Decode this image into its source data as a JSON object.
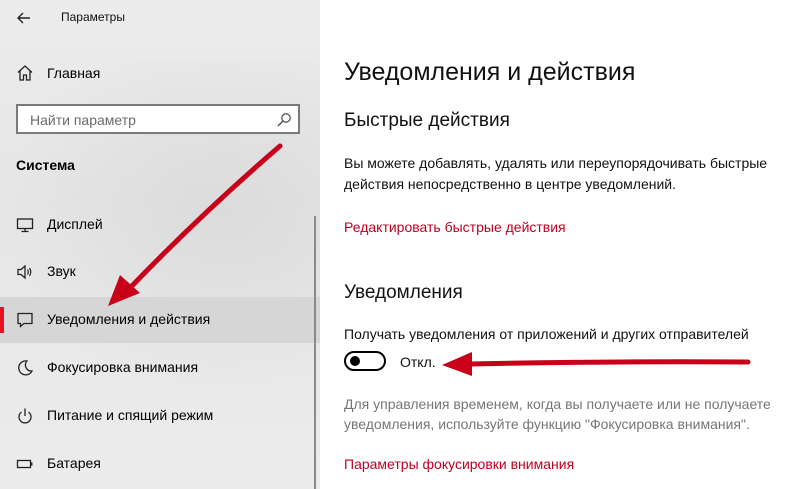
{
  "window": {
    "title": "Параметры"
  },
  "sidebar": {
    "home_label": "Главная",
    "search_placeholder": "Найти параметр",
    "section_title": "Система",
    "items": [
      {
        "label": "Дисплей",
        "icon": "monitor-icon",
        "active": false
      },
      {
        "label": "Звук",
        "icon": "speaker-icon",
        "active": false
      },
      {
        "label": "Уведомления и действия",
        "icon": "message-icon",
        "active": true
      },
      {
        "label": "Фокусировка внимания",
        "icon": "moon-icon",
        "active": false
      },
      {
        "label": "Питание и спящий режим",
        "icon": "power-icon",
        "active": false
      },
      {
        "label": "Батарея",
        "icon": "battery-icon",
        "active": false
      }
    ]
  },
  "main": {
    "title": "Уведомления и действия",
    "quick_actions": {
      "heading": "Быстрые действия",
      "description": "Вы можете добавлять, удалять или переупорядочивать быстрые действия непосредственно в центре уведомлений.",
      "edit_link": "Редактировать быстрые действия"
    },
    "notifications": {
      "heading": "Уведомления",
      "setting_label": "Получать уведомления от приложений и других отправителей",
      "toggle_state": "Откл.",
      "toggle_on": false,
      "hint": "Для управления временем, когда вы получаете или не получаете уведомления, используйте функцию \"Фокусировка внимания\".",
      "focus_link": "Параметры фокусировки внимания"
    }
  },
  "colors": {
    "accent": "#e81123",
    "link": "#c00021",
    "annotation_arrow": "#c8001a"
  }
}
